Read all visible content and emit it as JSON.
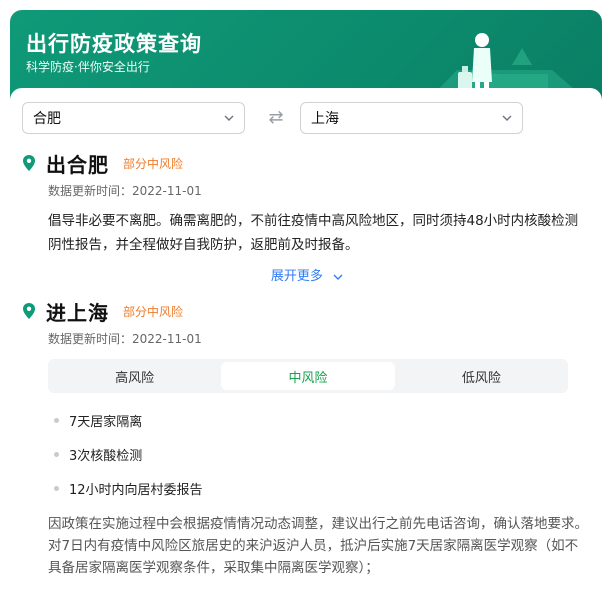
{
  "header": {
    "title": "出行防疫政策查询",
    "subtitle": "科学防疫·伴你安全出行"
  },
  "route": {
    "from_city": "合肥",
    "to_city": "上海"
  },
  "departure": {
    "title": "出合肥",
    "risk_tag": "部分中风险",
    "updated_label": "数据更新时间：2022-11-01",
    "policy_text": "倡导非必要不离肥。确需离肥的，不前往疫情中高风险地区，同时须持48小时内核酸检测阴性报告，并全程做好自我防护，返肥前及时报备。",
    "expand_label": "展开更多"
  },
  "arrival": {
    "title": "进上海",
    "risk_tag": "部分中风险",
    "updated_label": "数据更新时间：2022-11-01",
    "tabs": [
      {
        "label": "高风险",
        "active": false
      },
      {
        "label": "中风险",
        "active": true
      },
      {
        "label": "低风险",
        "active": false
      }
    ],
    "requirements": [
      "7天居家隔离",
      "3次核酸检测",
      "12小时内向居村委报告"
    ],
    "note_1": "因政策在实施过程中会根据疫情情况动态调整，建议出行之前先电话咨询，确认落地要求。",
    "note_2": "对7日内有疫情中风险区旅居史的来沪返沪人员，抵沪后实施7天居家隔离医学观察（如不具备居家隔离医学观察条件，采取集中隔离医学观察）；"
  },
  "colors": {
    "brand_green": "#0f9a78",
    "risk_orange": "#f07c2a",
    "active_tab_green": "#18a04d",
    "link_blue": "#2f7df6"
  },
  "icons": {
    "pin": "location-pin-icon",
    "swap": "swap-arrows-icon",
    "dropdown": "chevron-down-icon"
  }
}
